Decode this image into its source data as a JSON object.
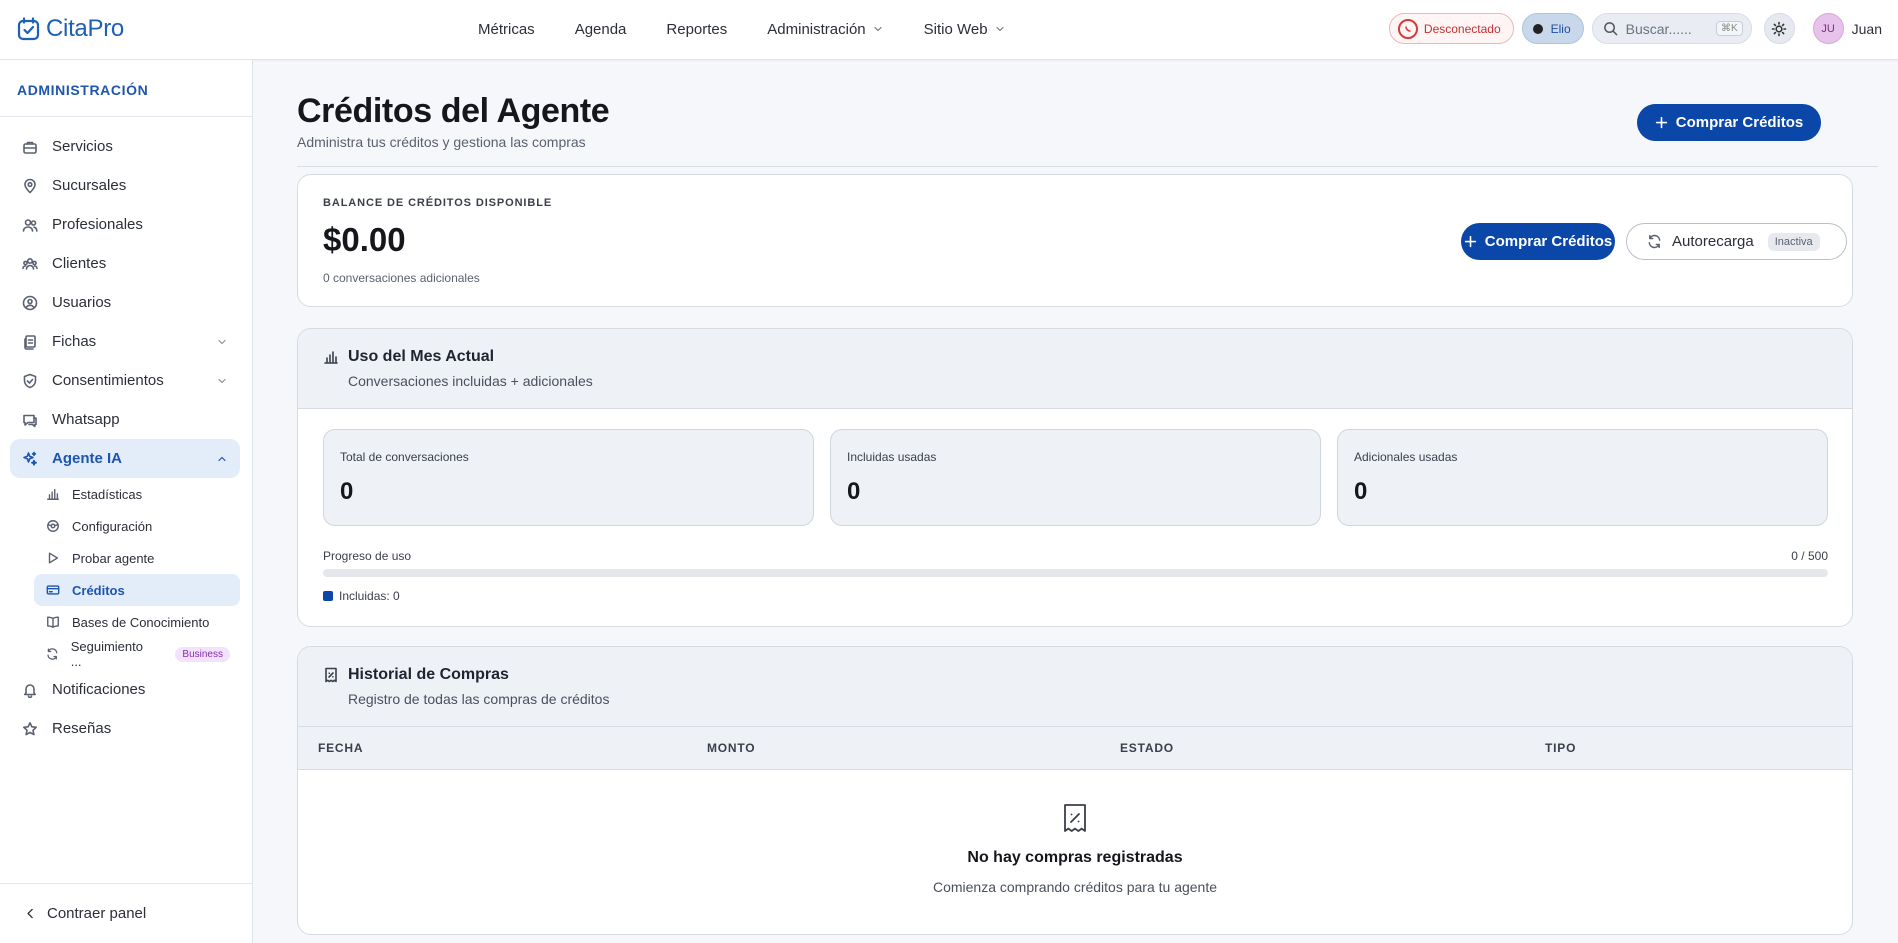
{
  "brand": {
    "logo": "CitaPro",
    "accent": "#0b47a8"
  },
  "nav": {
    "items": [
      {
        "label": "Métricas"
      },
      {
        "label": "Agenda"
      },
      {
        "label": "Reportes"
      },
      {
        "label": "Administración",
        "dropdown": true
      },
      {
        "label": "Sitio Web",
        "dropdown": true
      }
    ]
  },
  "topbar": {
    "whatsapp_status": "Desconectado",
    "agent_chip": "Elio",
    "search_placeholder": "Buscar......",
    "search_shortcut": "⌘K",
    "user_initials": "JU",
    "user_name": "Juan"
  },
  "sidebar": {
    "title": "ADMINISTRACIÓN",
    "items": [
      {
        "label": "Servicios",
        "icon": "briefcase-icon"
      },
      {
        "label": "Sucursales",
        "icon": "map-pin-icon"
      },
      {
        "label": "Profesionales",
        "icon": "users-icon"
      },
      {
        "label": "Clientes",
        "icon": "users-group-icon"
      },
      {
        "label": "Usuarios",
        "icon": "user-circle-icon"
      },
      {
        "label": "Fichas",
        "icon": "files-icon",
        "expandable": true
      },
      {
        "label": "Consentimientos",
        "icon": "shield-check-icon",
        "expandable": true
      },
      {
        "label": "Whatsapp",
        "icon": "message-icon"
      },
      {
        "label": "Agente IA",
        "icon": "sparkles-icon",
        "expanded": true,
        "active": true
      }
    ],
    "subitems": [
      {
        "label": "Estadísticas",
        "icon": "bar-chart-icon"
      },
      {
        "label": "Configuración",
        "icon": "settings-icon"
      },
      {
        "label": "Probar agente",
        "icon": "play-icon"
      },
      {
        "label": "Créditos",
        "icon": "credit-card-icon",
        "active": true
      },
      {
        "label": "Bases de Conocimiento",
        "icon": "book-icon"
      },
      {
        "label": "Seguimiento ...",
        "icon": "refresh-icon",
        "badge": "Business"
      }
    ],
    "after": [
      {
        "label": "Notificaciones",
        "icon": "bell-icon"
      },
      {
        "label": "Reseñas",
        "icon": "star-icon"
      }
    ],
    "collapse_label": "Contraer panel"
  },
  "page": {
    "title": "Créditos del Agente",
    "subtitle": "Administra tus créditos y gestiona las compras",
    "buy_button": "Comprar Créditos"
  },
  "balance": {
    "label": "BALANCE DE CRÉDITOS DISPONIBLE",
    "amount": "$0.00",
    "sub": "0 conversaciones adicionales",
    "buy_button": "Comprar Créditos",
    "autorecharge_label": "Autorecarga",
    "autorecharge_status": "Inactiva"
  },
  "usage": {
    "title": "Uso del Mes Actual",
    "subtitle": "Conversaciones incluidas + adicionales",
    "stats": [
      {
        "label": "Total de conversaciones",
        "value": "0"
      },
      {
        "label": "Incluidas usadas",
        "value": "0"
      },
      {
        "label": "Adicionales usadas",
        "value": "0"
      }
    ],
    "progress_label": "Progreso de uso",
    "progress_count": "0 / 500",
    "progress_fraction": 0,
    "legend_included": "Incluidas: 0"
  },
  "history": {
    "title": "Historial de Compras",
    "subtitle": "Registro de todas las compras de créditos",
    "columns": [
      "FECHA",
      "MONTO",
      "ESTADO",
      "TIPO"
    ],
    "empty_title": "No hay compras registradas",
    "empty_sub": "Comienza comprando créditos para tu agente"
  }
}
